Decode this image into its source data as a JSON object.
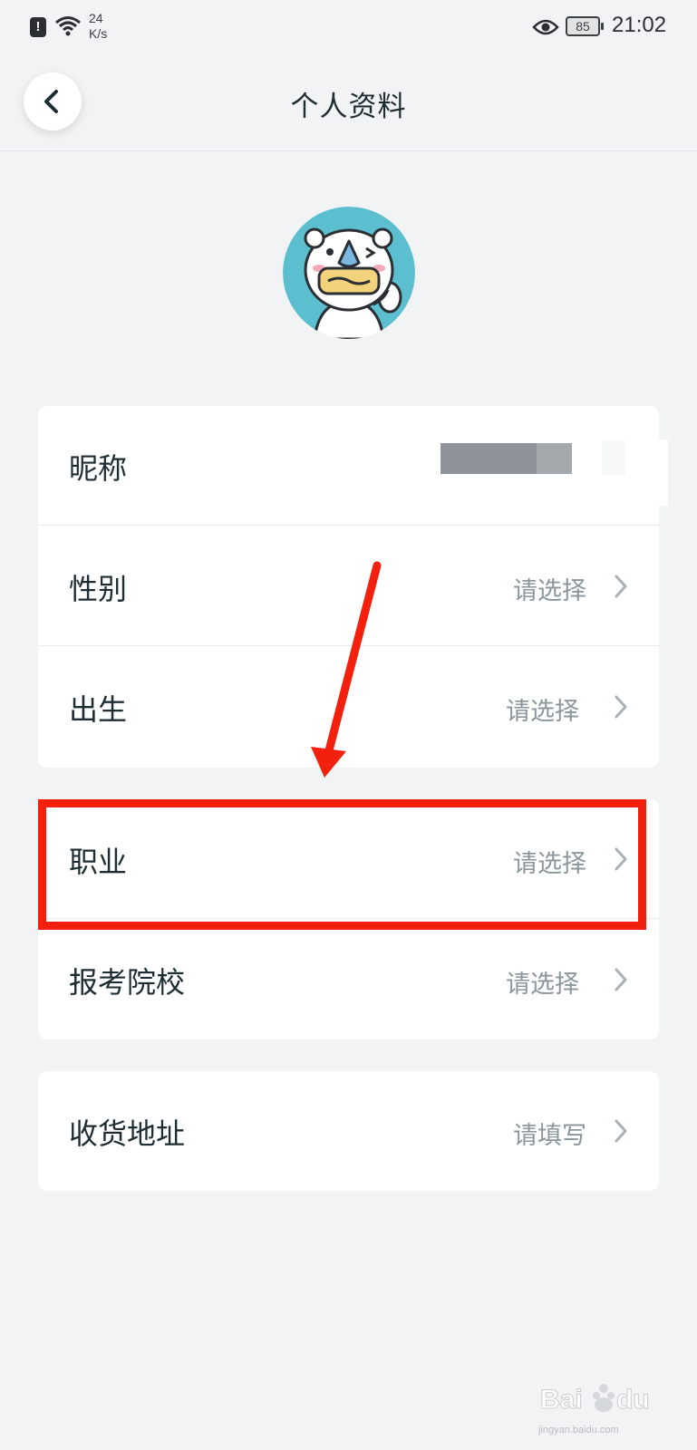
{
  "status_bar": {
    "net_speed_value": "24",
    "net_speed_unit": "K/s",
    "battery": "85",
    "time": "21:02"
  },
  "header": {
    "title": "个人资料",
    "back_icon": "chevron-left-icon"
  },
  "profile": {
    "avatar_icon": "cartoon-bear-avatar",
    "groups": [
      {
        "rows": [
          {
            "label": "昵称",
            "value": ""
          },
          {
            "label": "性别",
            "value": "请选择"
          },
          {
            "label": "出生",
            "value": "请选择"
          }
        ]
      },
      {
        "rows": [
          {
            "label": "职业",
            "value": "请选择"
          },
          {
            "label": "报考院校",
            "value": "请选择"
          }
        ]
      },
      {
        "rows": [
          {
            "label": "收货地址",
            "value": "请填写"
          }
        ]
      }
    ]
  },
  "annotations": {
    "highlight_color": "#f2200c",
    "arrow_color": "#f2200c"
  },
  "colors": {
    "background": "#f2f3f5",
    "card": "#ffffff",
    "text_primary": "#1e2d33",
    "text_secondary": "#8a969b",
    "avatar_bg": "#5bbfcf"
  },
  "watermark": {
    "text": "jingyan.baidu.com"
  }
}
